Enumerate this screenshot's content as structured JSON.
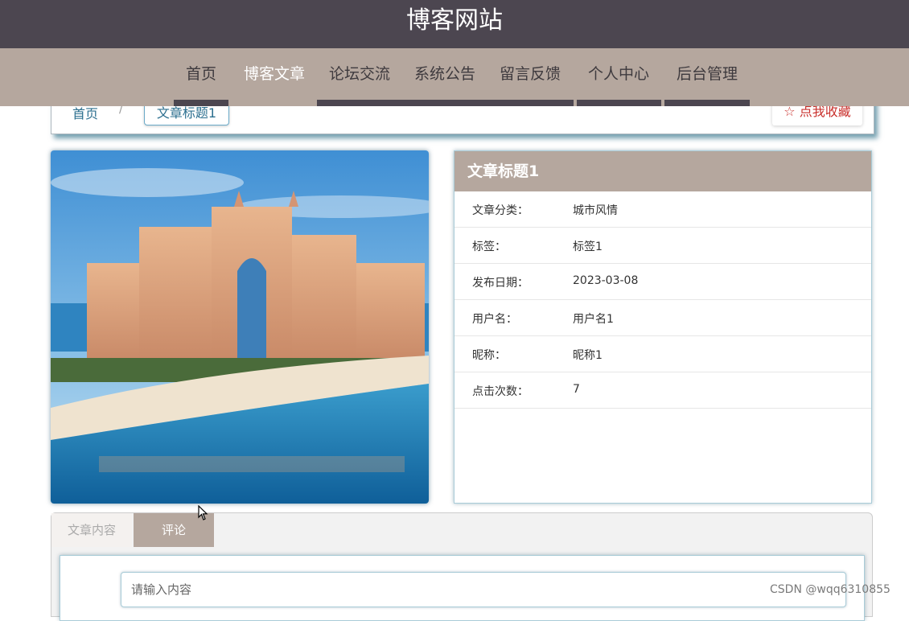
{
  "header": {
    "site_title": "博客网站"
  },
  "nav": {
    "items": [
      {
        "label": "首页"
      },
      {
        "label": "博客文章"
      },
      {
        "label": "论坛交流"
      },
      {
        "label": "系统公告"
      },
      {
        "label": "留言反馈"
      },
      {
        "label": "个人中心"
      },
      {
        "label": "后台管理"
      }
    ],
    "active_index": 1
  },
  "breadcrumb": {
    "home": "首页",
    "separator": "/",
    "current": "文章标题1"
  },
  "favorite": {
    "label": "☆ 点我收藏"
  },
  "article": {
    "image_alt": "城市风情",
    "title": "文章标题1",
    "fields": [
      {
        "label": "文章分类：",
        "value": "城市风情"
      },
      {
        "label": "标签：",
        "value": "标签1"
      },
      {
        "label": "发布日期：",
        "value": "2023-03-08"
      },
      {
        "label": "用户名：",
        "value": "用户名1"
      },
      {
        "label": "昵称：",
        "value": "昵称1"
      },
      {
        "label": "点击次数：",
        "value": "7"
      }
    ]
  },
  "tabs": {
    "content": "文章内容",
    "comment": "评论"
  },
  "comment": {
    "placeholder": "请输入内容"
  },
  "watermark": "CSDN @wqq6310855",
  "colors": {
    "topbar": "#4c4650",
    "navbar": "#b5a79e",
    "accent": "#b5a79e",
    "link": "#2c6f8f",
    "favorite": "#c9302c"
  }
}
